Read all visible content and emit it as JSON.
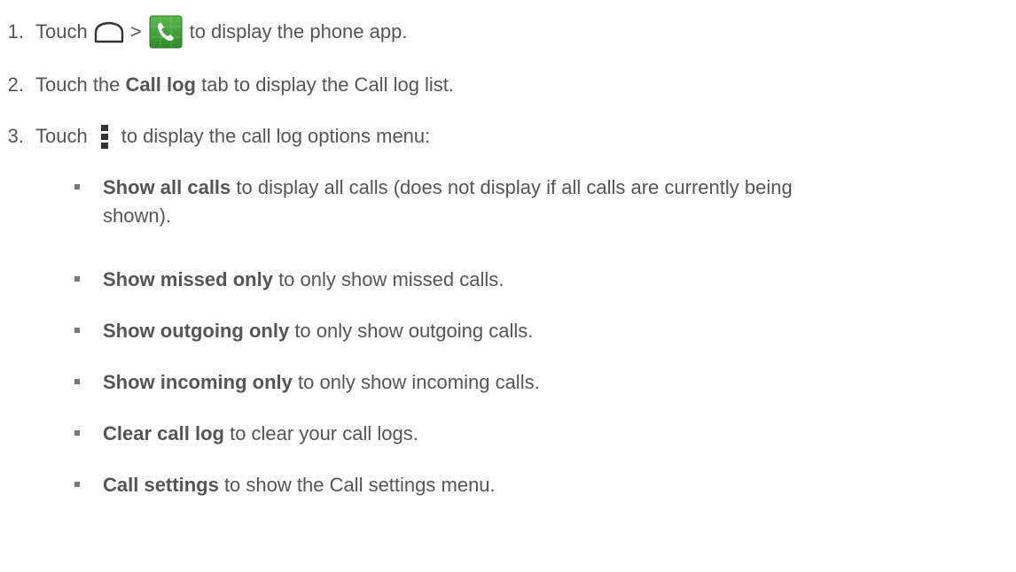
{
  "steps": [
    {
      "number": "1.",
      "before": "Touch",
      "separator": ">",
      "after": "to display the phone app.",
      "icons": [
        "home-outline-icon",
        "phone-app-icon"
      ]
    },
    {
      "number": "2.",
      "before": "Touch the",
      "bold": "Call log",
      "after": "tab to display the Call log list."
    },
    {
      "number": "3.",
      "before": "Touch",
      "after": "to display the call log options menu:",
      "icons": [
        "menu-dots-icon"
      ]
    }
  ],
  "options": [
    {
      "bold": "Show all calls",
      "text": "to display all calls (does not display if all calls are currently being",
      "text2": "shown)."
    },
    {
      "bold": "Show missed only",
      "text": "to only show missed calls."
    },
    {
      "bold": "Show outgoing only",
      "text": "to only show outgoing calls."
    },
    {
      "bold": "Show incoming only",
      "text": "to only show incoming calls."
    },
    {
      "bold": "Clear call log",
      "text": "to clear your call logs."
    },
    {
      "bold": "Call settings",
      "text": "to show the Call settings menu."
    }
  ],
  "colors": {
    "text": "#555555",
    "phone_icon_green": "#3f9a3a",
    "icon_dark": "#333333"
  }
}
